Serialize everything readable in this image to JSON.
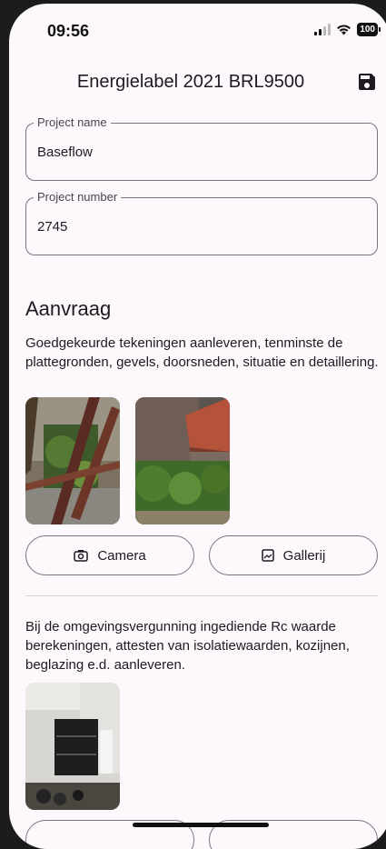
{
  "status": {
    "time": "09:56",
    "battery": "100"
  },
  "appbar": {
    "title": "Energielabel 2021 BRL9500",
    "save_icon": "save-icon"
  },
  "fields": {
    "project_name": {
      "label": "Project name",
      "value": "Baseflow"
    },
    "project_number": {
      "label": "Project number",
      "value": "2745"
    }
  },
  "section": {
    "title": "Aanvraag",
    "items": [
      {
        "text": "Goedgekeurde tekeningen aanleveren, tenminste de plattegronden, gevels, doorsneden, situatie en detaillering.",
        "camera_label": "Camera",
        "gallery_label": "Gallerij"
      },
      {
        "text": "Bij de omgevingsvergunning ingediende Rc waarde berekeningen, attesten van isolatiewaarden, kozijnen, beglazing e.d. aanleveren."
      }
    ]
  },
  "colors": {
    "background": "#fcf8fc",
    "outline": "#79747e",
    "text": "#1d1b20"
  }
}
